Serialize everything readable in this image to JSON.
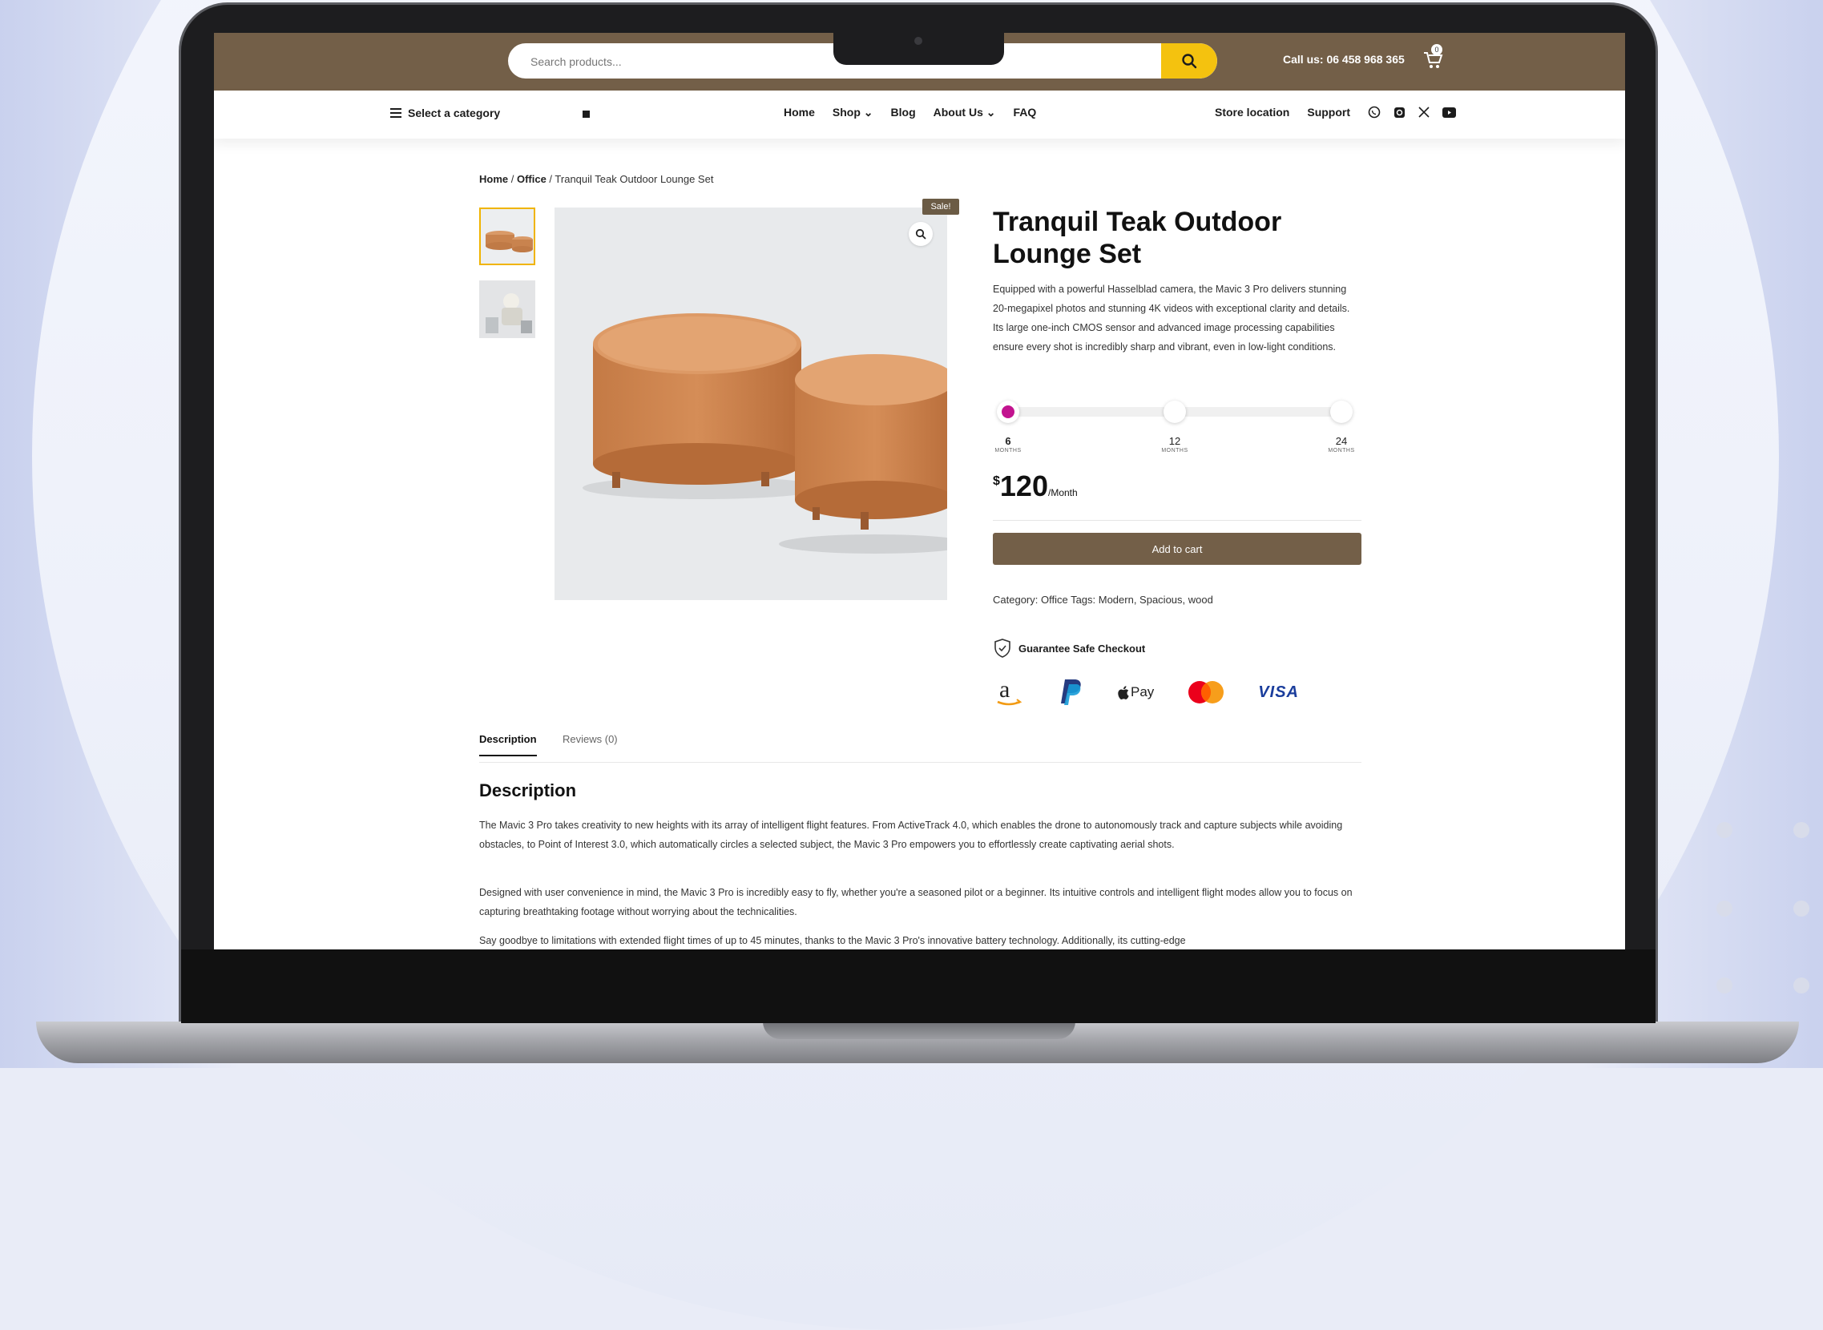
{
  "header": {
    "search_placeholder": "Search products...",
    "call_text": "Call us: 06 458 968 365",
    "cart_count": "0"
  },
  "nav": {
    "category_label": "Select a category",
    "menu": [
      "Home",
      "Shop",
      "Blog",
      "About Us",
      "FAQ"
    ],
    "right_links": [
      "Store location",
      "Support"
    ],
    "social_icons": [
      "whatsapp-icon",
      "instagram-icon",
      "x-icon",
      "youtube-icon"
    ]
  },
  "breadcrumb": {
    "home": "Home",
    "sep1": " / ",
    "category": "Office",
    "sep2": " / ",
    "current": "Tranquil Teak Outdoor Lounge Set"
  },
  "product": {
    "sale_badge": "Sale!",
    "title": "Tranquil Teak Outdoor Lounge Set",
    "description": "Equipped with a powerful Hasselblad camera, the Mavic 3 Pro delivers stunning 20-megapixel photos and stunning 4K videos with exceptional clarity and details. Its large one-inch CMOS sensor and advanced image processing capabilities ensure every shot is incredibly sharp and vibrant, even in low-light conditions.",
    "plans": [
      {
        "value": "6",
        "unit": "MONTHS",
        "selected": true
      },
      {
        "value": "12",
        "unit": "MONTHS",
        "selected": false
      },
      {
        "value": "24",
        "unit": "MONTHS",
        "selected": false
      }
    ],
    "price_currency": "$",
    "price_amount": "120",
    "price_period": "/Month",
    "add_to_cart": "Add to cart",
    "meta": "Category: Office  Tags: Modern, Spacious, wood",
    "guarantee": "Guarantee Safe Checkout",
    "payment_methods": [
      "amazon-icon",
      "paypal-icon",
      "apple-pay-icon",
      "mastercard-icon",
      "visa-icon"
    ],
    "apple_pay_text": "Pay",
    "visa_text": "VISA",
    "accent_color": "#735f48",
    "sale_color": "#6b5b45",
    "search_button_color": "#f4c20f",
    "selected_plan_color": "#c2138f"
  },
  "tabs": {
    "description": "Description",
    "reviews": "Reviews (0)"
  },
  "content": {
    "heading": "Description",
    "p1": "The Mavic 3 Pro takes creativity to new heights with its array of intelligent flight features. From ActiveTrack 4.0, which enables the drone to autonomously track and capture subjects while avoiding obstacles, to Point of Interest 3.0, which automatically circles a selected subject, the Mavic 3 Pro empowers you to effortlessly create captivating aerial shots.",
    "p2": "Designed with user convenience in mind, the Mavic 3 Pro is incredibly easy to fly, whether you're a seasoned pilot or a beginner. Its intuitive controls and intelligent flight modes allow you to focus on capturing breathtaking footage without worrying about the technicalities.",
    "p3": "Say goodbye to limitations with extended flight times of up to 45 minutes, thanks to the Mavic 3 Pro's innovative battery technology. Additionally, its cutting-edge"
  }
}
